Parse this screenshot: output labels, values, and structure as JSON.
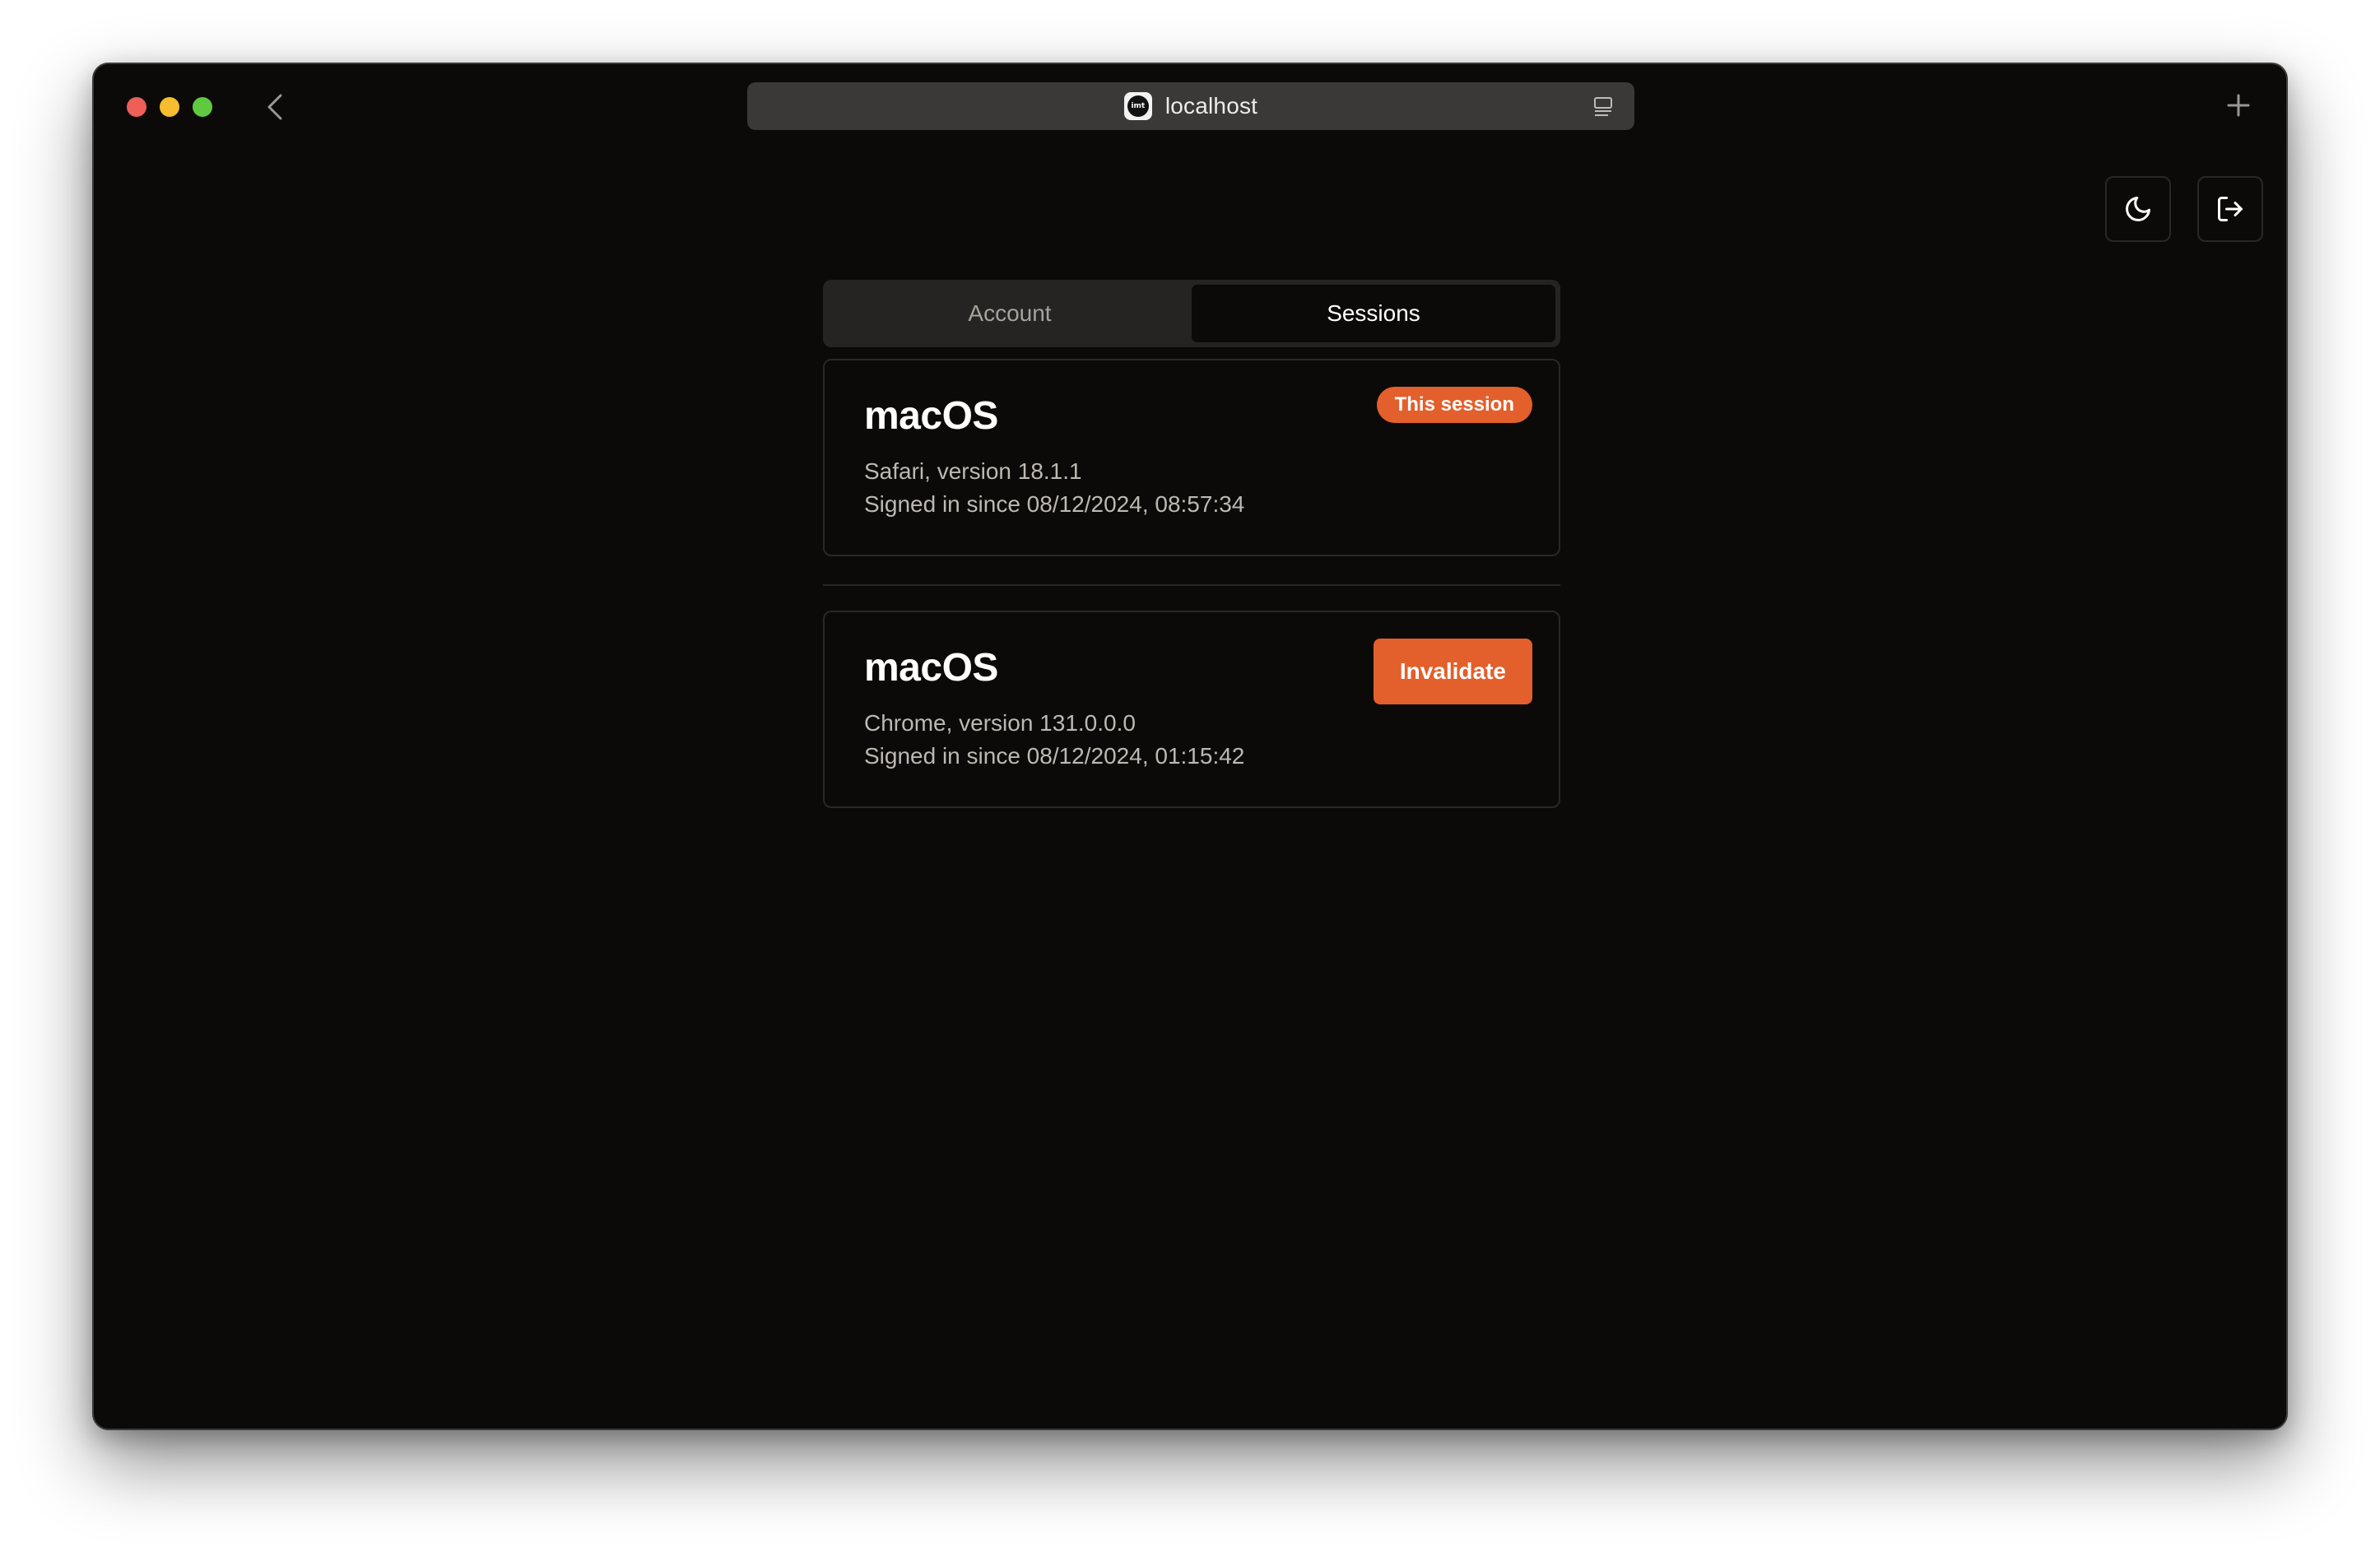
{
  "browser": {
    "url": "localhost",
    "site_icon_label": "imt"
  },
  "tabs": [
    {
      "label": "Account",
      "active": false
    },
    {
      "label": "Sessions",
      "active": true
    }
  ],
  "sessions": [
    {
      "os": "macOS",
      "browser": "Safari, version 18.1.1",
      "signed_in": "Signed in since 08/12/2024, 08:57:34",
      "badge": "This session"
    },
    {
      "os": "macOS",
      "browser": "Chrome, version 131.0.0.0",
      "signed_in": "Signed in since 08/12/2024, 01:15:42",
      "action": "Invalidate"
    }
  ],
  "colors": {
    "accent": "#e35f2b",
    "background": "#0b0a09",
    "border": "#2a2826"
  },
  "icons": {
    "theme_toggle": "moon-icon",
    "logout": "logout-icon",
    "back": "chevron-left-icon",
    "new_tab": "plus-icon",
    "reader": "reader-icon"
  }
}
